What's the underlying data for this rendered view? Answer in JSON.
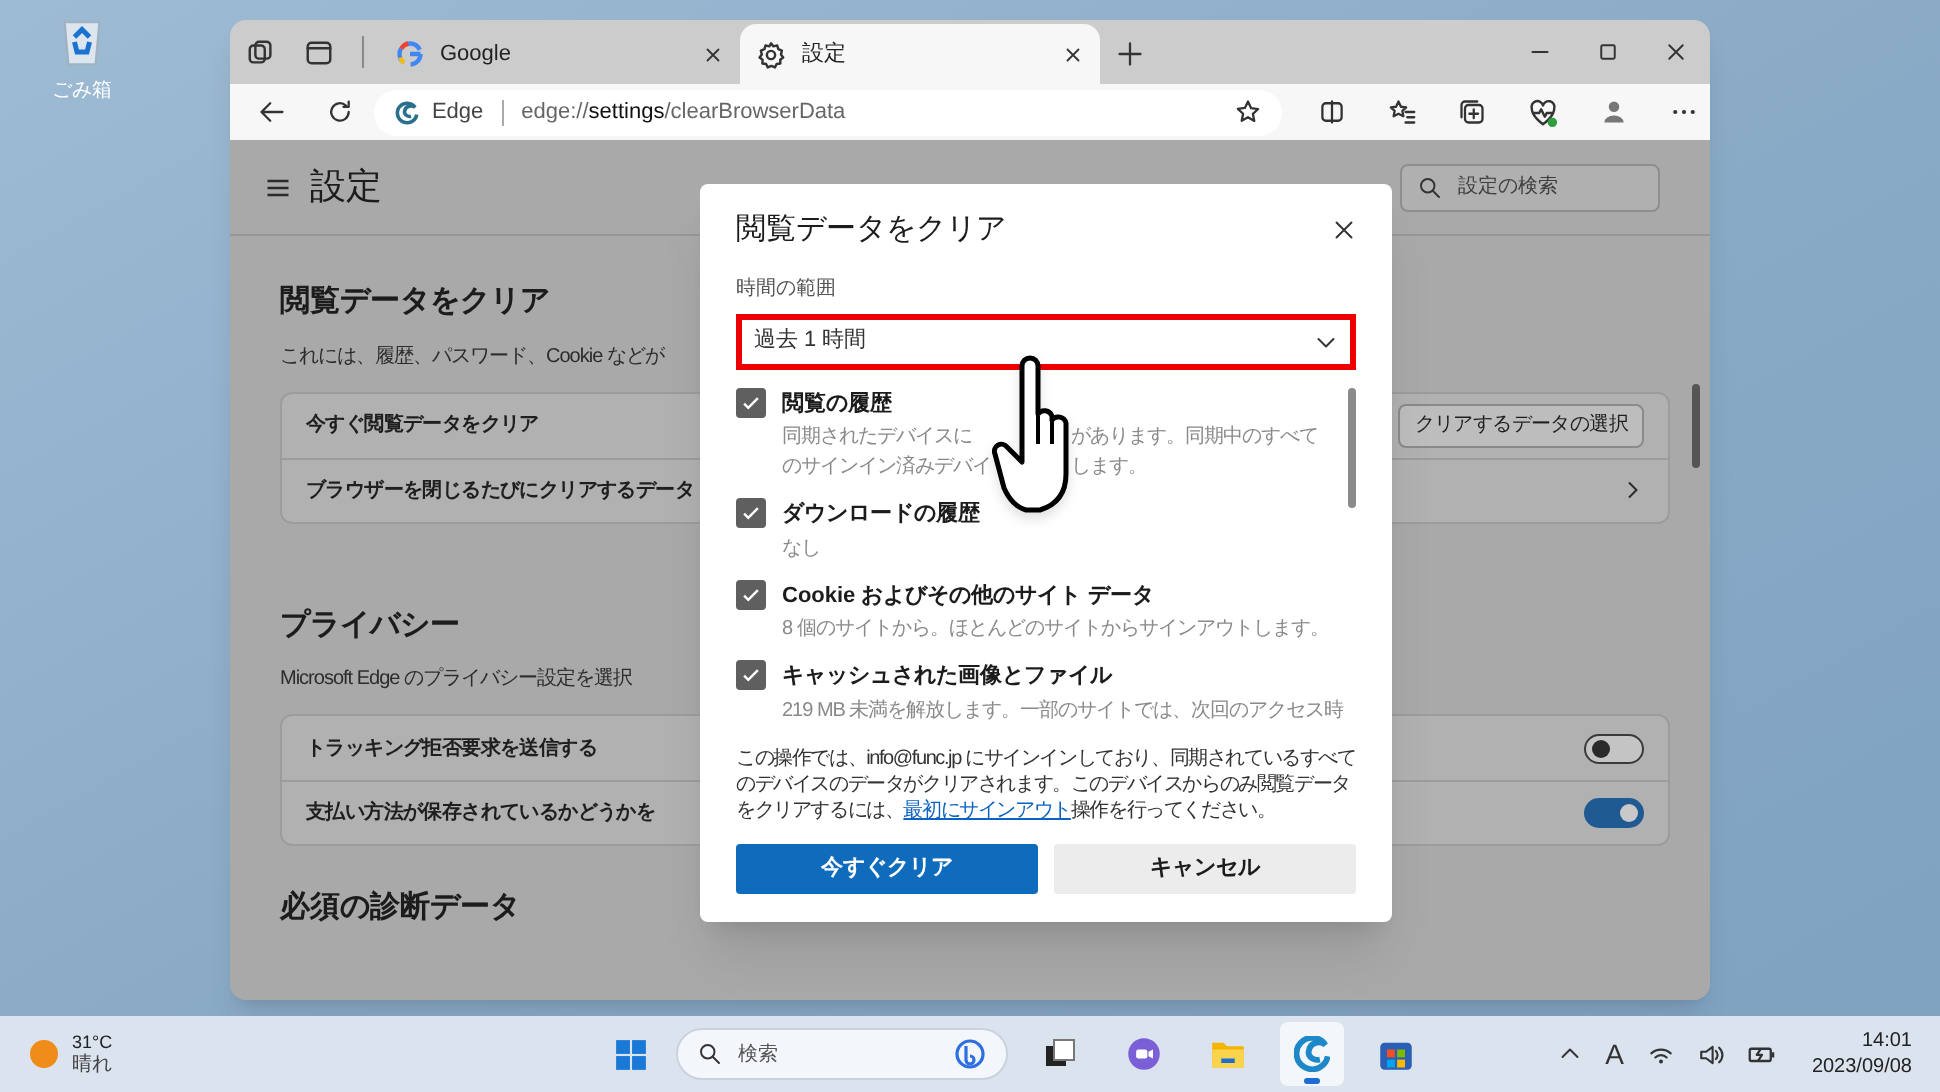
{
  "desktop": {
    "icons": [
      {
        "label": "ごみ箱"
      }
    ]
  },
  "browser": {
    "tabs": [
      {
        "title": "Google",
        "kind": "google",
        "selected": false
      },
      {
        "title": "設定",
        "kind": "settings",
        "selected": true
      }
    ],
    "address_bar": {
      "site_label": "Edge",
      "url": "edge://**settings**/clearBrowserData"
    }
  },
  "settings": {
    "title": "設定",
    "search": {
      "placeholder": "設定の検索"
    },
    "sections": [
      {
        "heading": "閲覧データをクリア",
        "description": "これには、履歴、パスワード、Cookie などが",
        "rows": [
          {
            "label": "今すぐ閲覧データをクリア",
            "kind": "button",
            "button": "クリアするデータの選択"
          },
          {
            "label": "ブラウザーを閉じるたびにクリアするデータ",
            "kind": "link"
          }
        ]
      },
      {
        "heading": "プライバシー",
        "description": "Microsoft Edge のプライバシー設定を選択",
        "rows": [
          {
            "label": "トラッキング拒否要求を送信する",
            "kind": "toggle",
            "on": false
          },
          {
            "label": "支払い方法が保存されているかどうかを",
            "kind": "toggle",
            "on": true
          }
        ]
      },
      {
        "heading": "必須の診断データ"
      }
    ]
  },
  "dialog": {
    "title": "閲覧データをクリア",
    "time_range": {
      "label": "時間の範囲",
      "value": "過去 1 時間"
    },
    "items": [
      {
        "title": "閲覧の履歴",
        "description_lines": [
          [
            "同期されたデバイスに",
            "があります。同期中のすべて"
          ],
          [
            "のサインイン済みデバイ",
            "します。"
          ]
        ],
        "checked": true
      },
      {
        "title": "ダウンロードの履歴",
        "description": "なし",
        "checked": true
      },
      {
        "title": "Cookie およびその他のサイト データ",
        "description": "8 個のサイトから。ほとんどのサイトからサインアウトします。",
        "checked": true
      },
      {
        "title": "キャッシュされた画像とファイル",
        "description": "219 MB 未満を解放します。一部のサイトでは、次回のアクセス時",
        "checked": true
      }
    ],
    "notice": {
      "before": "この操作では、info@func.jp にサインインしており、同期されているすべてのデバイスのデータがクリアされます。このデバイスからのみ閲覧データをクリアするには、",
      "link": "最初にサインアウト",
      "after": "操作を行ってください。"
    },
    "buttons": [
      {
        "label": "今すぐクリア",
        "kind": "primary"
      },
      {
        "label": "キャンセル",
        "kind": "secondary"
      }
    ]
  },
  "taskbar": {
    "weather": {
      "temperature": "31°C",
      "condition": "晴れ"
    },
    "search": {
      "placeholder": "検索"
    },
    "apps": [
      {
        "kind": "task-view",
        "selected": false
      },
      {
        "kind": "chat",
        "selected": false
      },
      {
        "kind": "explorer",
        "selected": false
      },
      {
        "kind": "edge",
        "selected": true
      },
      {
        "kind": "store",
        "selected": false
      }
    ],
    "ime": "A",
    "clock": {
      "time": "14:01",
      "date": "2023/09/08"
    }
  }
}
